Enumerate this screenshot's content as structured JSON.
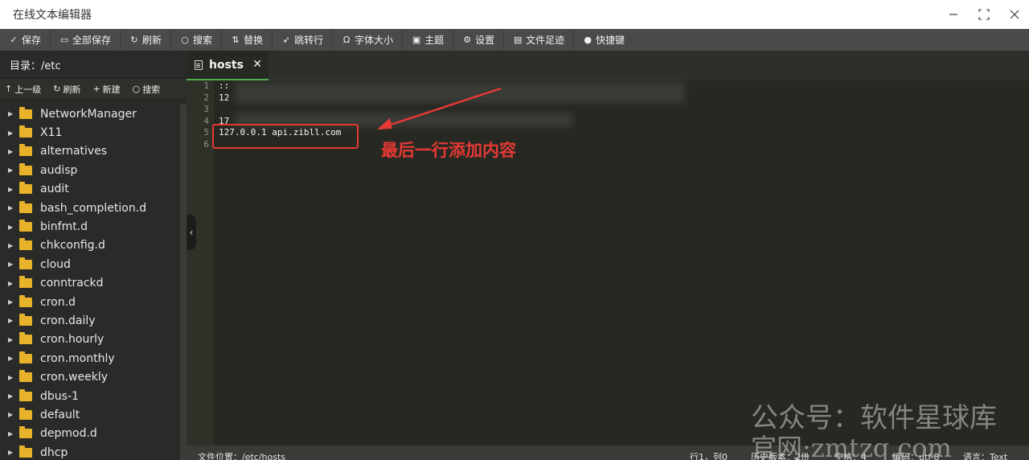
{
  "window": {
    "title": "在线文本编辑器",
    "controls": [
      "minimize-icon",
      "maximize-icon",
      "close-icon"
    ]
  },
  "toolbar": [
    {
      "icon": "save-icon",
      "label": "保存"
    },
    {
      "icon": "save-all-icon",
      "label": "全部保存"
    },
    {
      "icon": "refresh-icon",
      "label": "刷新"
    },
    {
      "icon": "search-icon",
      "label": "搜索"
    },
    {
      "icon": "replace-icon",
      "label": "替换"
    },
    {
      "icon": "goto-line-icon",
      "label": "跳转行"
    },
    {
      "icon": "font-size-icon",
      "label": "字体大小"
    },
    {
      "icon": "theme-icon",
      "label": "主题"
    },
    {
      "icon": "settings-icon",
      "label": "设置"
    },
    {
      "icon": "history-icon",
      "label": "文件足迹"
    },
    {
      "icon": "shortcut-icon",
      "label": "快捷键"
    }
  ],
  "sidebar": {
    "directory_label": "目录：/etc",
    "tools": [
      {
        "icon": "arrow-up-icon",
        "label": "上一级"
      },
      {
        "icon": "refresh-icon",
        "label": "刷新"
      },
      {
        "icon": "plus-icon",
        "label": "新建"
      },
      {
        "icon": "search-icon",
        "label": "搜索"
      }
    ],
    "items": [
      "NetworkManager",
      "X11",
      "alternatives",
      "audisp",
      "audit",
      "bash_completion.d",
      "binfmt.d",
      "chkconfig.d",
      "cloud",
      "conntrackd",
      "cron.d",
      "cron.daily",
      "cron.hourly",
      "cron.monthly",
      "cron.weekly",
      "dbus-1",
      "default",
      "depmod.d",
      "dhcp"
    ]
  },
  "tab": {
    "name": "hosts",
    "close_label": "✕"
  },
  "editor": {
    "line_numbers": [
      "1",
      "2",
      "3",
      "4",
      "5",
      "6"
    ],
    "lines": [
      "::",
      "12",
      "",
      "17",
      "127.0.0.1 api.zibll.com",
      ""
    ],
    "annotation": "最后一行添加内容"
  },
  "statusbar": {
    "file_location": "文件位置：/etc/hosts",
    "cursor": "行1，列0",
    "history": "历史版本：2份",
    "indent": "空格：4",
    "encoding": "编码：utf-8",
    "language": "语言：Text"
  },
  "watermark": {
    "line1": "公众号：软件星球库",
    "line2": "官网:zmtzq.com"
  },
  "colors": {
    "accent_green": "#4cae4c",
    "annotation_red": "#e53935",
    "folder_yellow": "#e8b22a",
    "editor_bg": "#272822"
  }
}
